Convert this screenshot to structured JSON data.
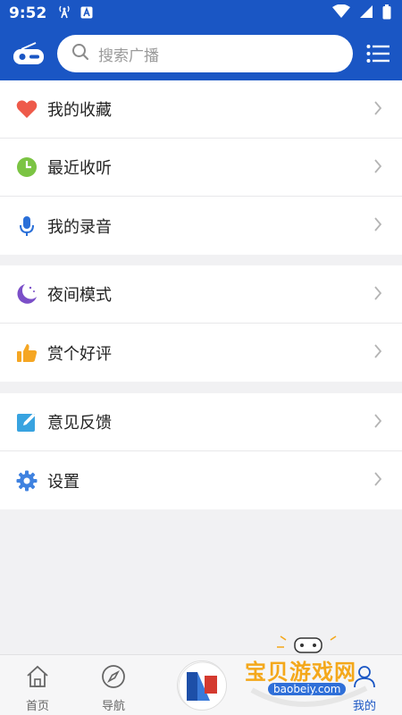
{
  "status_bar": {
    "time": "9:52"
  },
  "search": {
    "placeholder": "搜索广播"
  },
  "groups": [
    [
      {
        "label": "我的收藏",
        "icon": "heart-icon"
      },
      {
        "label": "最近收听",
        "icon": "clock-icon"
      },
      {
        "label": "我的录音",
        "icon": "microphone-icon"
      }
    ],
    [
      {
        "label": "夜间模式",
        "icon": "moon-icon"
      },
      {
        "label": "赏个好评",
        "icon": "thumbs-up-icon"
      }
    ],
    [
      {
        "label": "意见反馈",
        "icon": "edit-icon"
      },
      {
        "label": "设置",
        "icon": "gear-icon"
      }
    ]
  ],
  "bottom_nav": [
    {
      "label": "首页",
      "icon": "home-icon"
    },
    {
      "label": "导航",
      "icon": "compass-icon"
    },
    {
      "label": "",
      "icon": "center-logo"
    },
    {
      "label": "",
      "icon": ""
    },
    {
      "label": "我的",
      "icon": "user-icon"
    }
  ],
  "watermark": {
    "title": "宝贝游戏网",
    "url": "baobeiy.com"
  },
  "colors": {
    "brand": "#1a56c4",
    "background": "#f1f1f3"
  }
}
